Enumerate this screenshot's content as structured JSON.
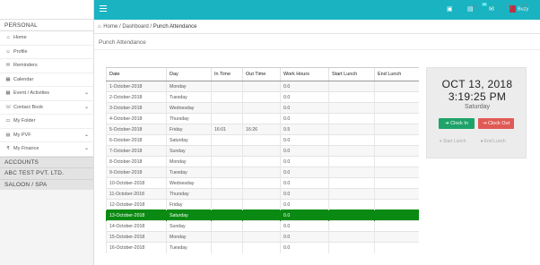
{
  "sidebar": {
    "personal_label": "PERSONAL",
    "items": [
      {
        "label": "Home",
        "icon": "home-icon",
        "glyph": "⌂",
        "chevron": false
      },
      {
        "label": "Profile",
        "icon": "user-icon",
        "glyph": "☺",
        "chevron": false
      },
      {
        "label": "Reminders",
        "icon": "bell-icon",
        "glyph": "✉",
        "chevron": false
      },
      {
        "label": "Calendar",
        "icon": "calendar-icon",
        "glyph": "▦",
        "chevron": false
      },
      {
        "label": "Event / Activities",
        "icon": "calendar-check-icon",
        "glyph": "▦",
        "chevron": true
      },
      {
        "label": "Contact Book",
        "icon": "contact-book-icon",
        "glyph": "☏",
        "chevron": true
      },
      {
        "label": "My Folder",
        "icon": "folder-icon",
        "glyph": "▭",
        "chevron": false
      },
      {
        "label": "My PVF",
        "icon": "file-icon",
        "glyph": "▤",
        "chevron": true
      },
      {
        "label": "My Finance",
        "icon": "rupee-icon",
        "glyph": "₹",
        "chevron": true
      }
    ],
    "sections": [
      "ACCOUNTS",
      "ABC TEST PVT. LTD.",
      "SALOON / SPA"
    ]
  },
  "topbar": {
    "badge": "35",
    "user_name": "Buzy",
    "accent_color": "#1ab3c2"
  },
  "breadcrumb": {
    "home": "Home",
    "dashboard": "Dashboard",
    "current": "Punch Attendance"
  },
  "page": {
    "title": "Punch Attendance"
  },
  "table": {
    "headers": [
      "Date",
      "Day",
      "In Time",
      "Out Time",
      "Work Hours",
      "Start Lunch",
      "End Lunch"
    ],
    "rows": [
      {
        "date": "1-October-2018",
        "day": "Monday",
        "in": "",
        "out": "",
        "hours": "0.0",
        "start_lunch": "",
        "end_lunch": ""
      },
      {
        "date": "2-October-2018",
        "day": "Tuesday",
        "in": "",
        "out": "",
        "hours": "0.0",
        "start_lunch": "",
        "end_lunch": ""
      },
      {
        "date": "3-October-2018",
        "day": "Wednesday",
        "in": "",
        "out": "",
        "hours": "0.0",
        "start_lunch": "",
        "end_lunch": ""
      },
      {
        "date": "4-October-2018",
        "day": "Thursday",
        "in": "",
        "out": "",
        "hours": "0.0",
        "start_lunch": "",
        "end_lunch": ""
      },
      {
        "date": "5-October-2018",
        "day": "Friday",
        "in": "16:01",
        "out": "16:26",
        "hours": "0.5",
        "start_lunch": "",
        "end_lunch": ""
      },
      {
        "date": "6-October-2018",
        "day": "Saturday",
        "in": "",
        "out": "",
        "hours": "0.0",
        "start_lunch": "",
        "end_lunch": ""
      },
      {
        "date": "7-October-2018",
        "day": "Sunday",
        "in": "",
        "out": "",
        "hours": "0.0",
        "start_lunch": "",
        "end_lunch": ""
      },
      {
        "date": "8-October-2018",
        "day": "Monday",
        "in": "",
        "out": "",
        "hours": "0.0",
        "start_lunch": "",
        "end_lunch": ""
      },
      {
        "date": "9-October-2018",
        "day": "Tuesday",
        "in": "",
        "out": "",
        "hours": "0.0",
        "start_lunch": "",
        "end_lunch": ""
      },
      {
        "date": "10-October-2018",
        "day": "Wednesday",
        "in": "",
        "out": "",
        "hours": "0.0",
        "start_lunch": "",
        "end_lunch": ""
      },
      {
        "date": "11-October-2018",
        "day": "Thursday",
        "in": "",
        "out": "",
        "hours": "0.0",
        "start_lunch": "",
        "end_lunch": ""
      },
      {
        "date": "12-October-2018",
        "day": "Friday",
        "in": "",
        "out": "",
        "hours": "0.0",
        "start_lunch": "",
        "end_lunch": ""
      },
      {
        "date": "13-October-2018",
        "day": "Saturday",
        "in": "",
        "out": "",
        "hours": "0.0",
        "start_lunch": "",
        "end_lunch": ""
      },
      {
        "date": "14-October-2018",
        "day": "Sunday",
        "in": "",
        "out": "",
        "hours": "0.0",
        "start_lunch": "",
        "end_lunch": ""
      },
      {
        "date": "15-October-2018",
        "day": "Monday",
        "in": "",
        "out": "",
        "hours": "0.0",
        "start_lunch": "",
        "end_lunch": ""
      },
      {
        "date": "16-October-2018",
        "day": "Tuesday",
        "in": "",
        "out": "",
        "hours": "0.0",
        "start_lunch": "",
        "end_lunch": ""
      }
    ],
    "highlight_date": "13-October-2018",
    "highlight_color": "#0a8a12"
  },
  "clock": {
    "date": "OCT 13, 2018",
    "time": "3:19:25 PM",
    "day": "Saturday",
    "clock_in": "Clock In",
    "clock_out": "Clock Out",
    "start_lunch": "Start Lunch",
    "end_lunch": "End Lunch",
    "clock_in_color": "#1ea36a",
    "clock_out_color": "#e05a55"
  }
}
